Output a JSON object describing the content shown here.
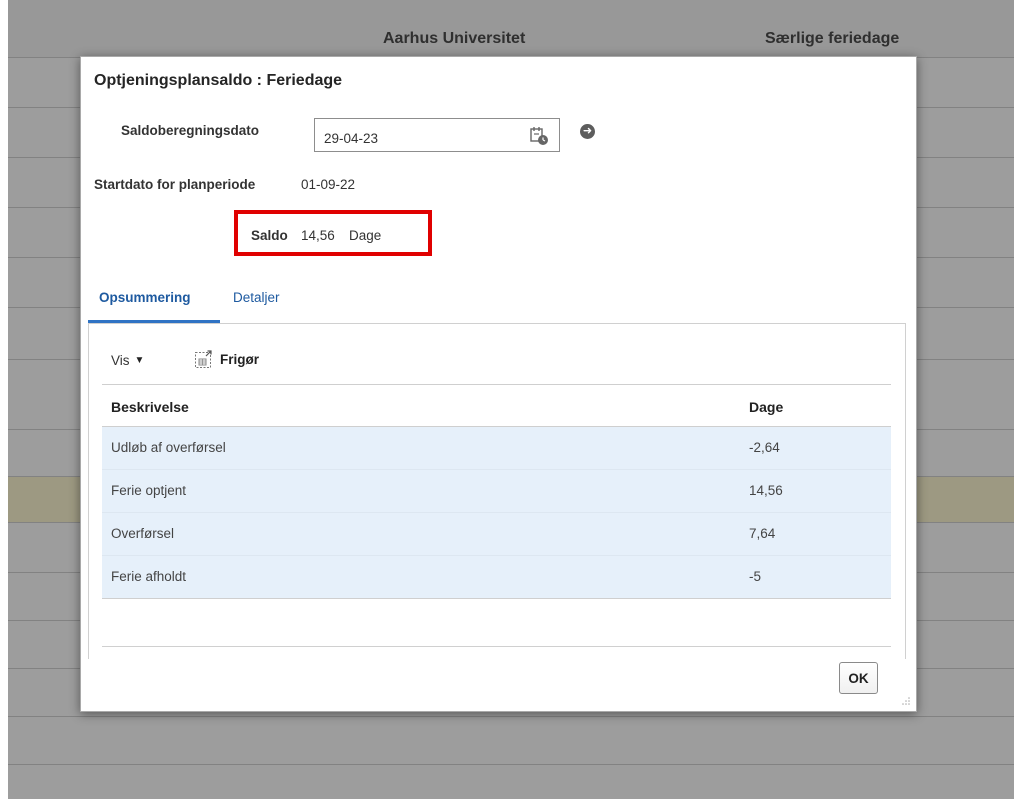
{
  "background": {
    "header_center": "Aarhus Universitet",
    "header_right": "Særlige feriedage"
  },
  "dialog": {
    "title": "Optjeningsplansaldo : Feriedage",
    "calc_date_label": "Saldoberegningsdato",
    "calc_date_value": "29-04-23",
    "start_date_label": "Startdato for planperiode",
    "start_date_value": "01-09-22",
    "balance_label": "Saldo",
    "balance_value": "14,56",
    "balance_unit": "Dage",
    "highlight_color": "#e00000",
    "tabs": [
      {
        "label": "Opsummering",
        "active": true
      },
      {
        "label": "Detaljer",
        "active": false
      }
    ],
    "toolbar": {
      "view_label": "Vis",
      "detach_label": "Frigør"
    },
    "table": {
      "columns": [
        "Beskrivelse",
        "Dage"
      ],
      "rows": [
        {
          "description": "Udløb af overførsel",
          "days": "-2,64"
        },
        {
          "description": "Ferie optjent",
          "days": "14,56"
        },
        {
          "description": "Overførsel",
          "days": "7,64"
        },
        {
          "description": "Ferie afholdt",
          "days": "-5"
        }
      ]
    },
    "ok_label": "OK"
  }
}
